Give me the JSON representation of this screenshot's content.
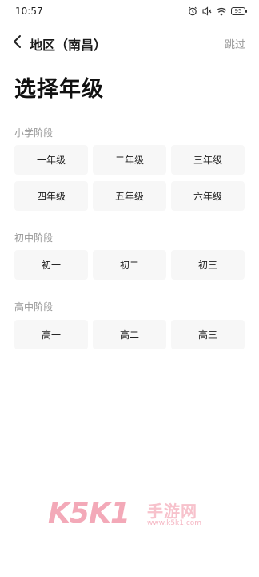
{
  "status_bar": {
    "time": "10:57",
    "battery": "95",
    "icons": [
      "alarm-icon",
      "mute-icon",
      "wifi-icon",
      "battery-icon"
    ]
  },
  "nav": {
    "title": "地区（南昌）",
    "skip_label": "跳过",
    "back_icon": "chevron-left-icon"
  },
  "page_title": "选择年级",
  "sections": [
    {
      "label": "小学阶段",
      "grades": [
        "一年级",
        "二年级",
        "三年级",
        "四年级",
        "五年级",
        "六年级"
      ]
    },
    {
      "label": "初中阶段",
      "grades": [
        "初一",
        "初二",
        "初三"
      ]
    },
    {
      "label": "高中阶段",
      "grades": [
        "高一",
        "高二",
        "高三"
      ]
    }
  ],
  "watermark": {
    "main": "K5K1",
    "cn": "手游网",
    "url": "www.k5k1.com"
  },
  "colors": {
    "background": "#ffffff",
    "button_bg": "#f7f7f7",
    "section_label": "#999999",
    "skip": "#9a9a9a",
    "watermark": "#f3a9b8"
  }
}
